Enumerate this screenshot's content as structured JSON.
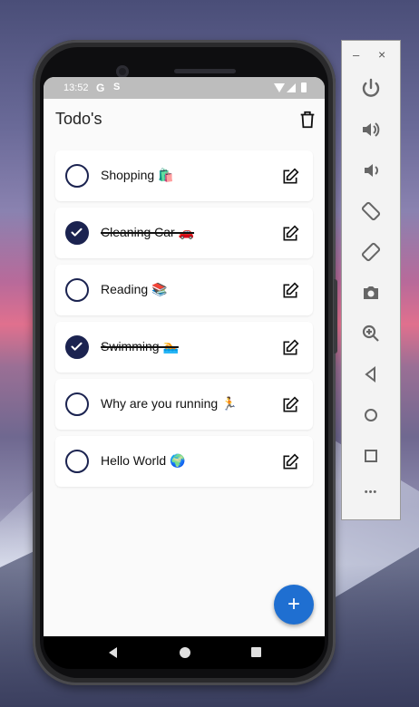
{
  "status_bar": {
    "time": "13:52",
    "icon_g": "G",
    "icon_s": "S"
  },
  "app": {
    "title": "Todo's"
  },
  "todos": [
    {
      "text": "Shopping 🛍️",
      "done": false
    },
    {
      "text": "Cleaning Car 🚗",
      "done": true
    },
    {
      "text": "Reading 📚",
      "done": false
    },
    {
      "text": "Swimming 🏊",
      "done": true
    },
    {
      "text": "Why are you running 🏃",
      "done": false
    },
    {
      "text": "Hello World 🌍",
      "done": false
    }
  ],
  "fab": {
    "label": "+"
  },
  "toolbar": {
    "minimize": "–",
    "close": "×",
    "more": "•••"
  },
  "colors": {
    "accent": "#1f6fd1",
    "check": "#1b2350"
  },
  "icons": [
    "power-icon",
    "volume-up-icon",
    "volume-down-icon",
    "rotate-left-icon",
    "rotate-right-icon",
    "camera-icon",
    "zoom-icon",
    "back-icon",
    "home-icon",
    "overview-icon",
    "more-icon"
  ]
}
